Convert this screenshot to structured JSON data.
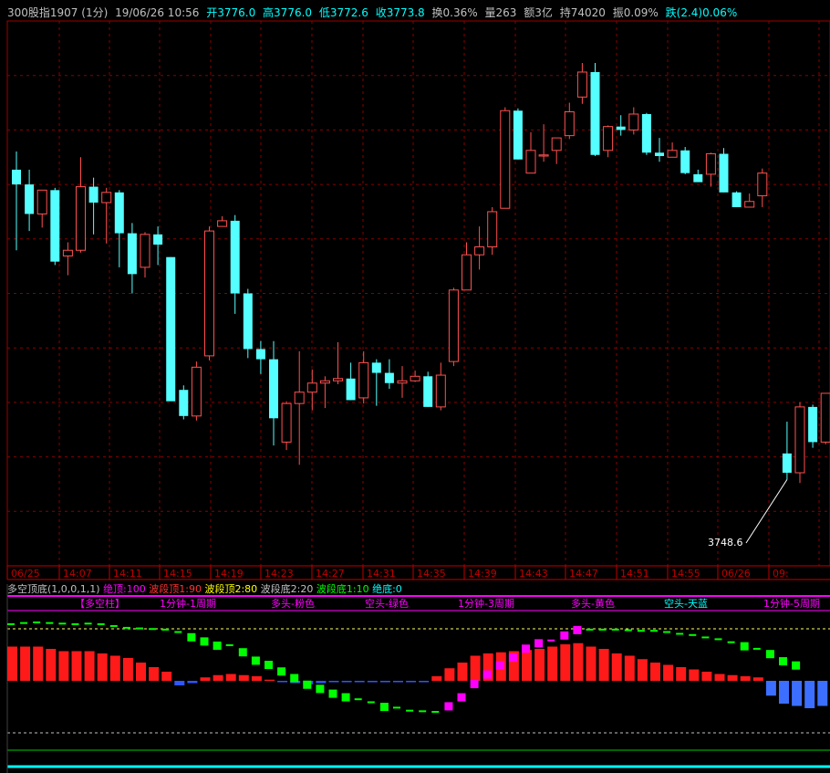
{
  "header": {
    "symbol": "300股指1907 (1分)",
    "datetime": "19/06/26 10:56",
    "open": "开3776.0",
    "high": "高3776.0",
    "low": "低3772.6",
    "close": "收3773.8",
    "turnover": "换0.36%",
    "volume": "量263",
    "amount": "额3亿",
    "position": "持74020",
    "amplitude": "振0.09%",
    "change": "跌(2.4)0.06%",
    "colors": {
      "neutral": "#c0c0c0",
      "up": "#ff5050",
      "down": "#00ffff",
      "amber": "#ffff00"
    }
  },
  "price_panel": {
    "low_annotation": "3748.6"
  },
  "chart_data": {
    "type": "candlestick",
    "candles": [
      [
        3775.9,
        3777.5,
        3768.8,
        3774.6
      ],
      [
        3774.6,
        3775.9,
        3770.5,
        3772.0
      ],
      [
        3772.0,
        3774.0,
        3770.8,
        3774.1
      ],
      [
        3774.1,
        3774.3,
        3767.5,
        3767.8
      ],
      [
        3768.3,
        3769.5,
        3766.6,
        3768.8
      ],
      [
        3768.8,
        3777.0,
        3768.6,
        3774.4
      ],
      [
        3774.4,
        3775.2,
        3770.2,
        3773.0
      ],
      [
        3773.0,
        3774.3,
        3769.4,
        3773.9
      ],
      [
        3773.9,
        3774.1,
        3767.3,
        3770.3
      ],
      [
        3770.3,
        3771.2,
        3765.0,
        3766.7
      ],
      [
        3767.3,
        3770.4,
        3766.4,
        3770.2
      ],
      [
        3770.2,
        3770.9,
        3767.5,
        3769.3
      ],
      [
        3768.2,
        3768.2,
        3755.6,
        3755.5
      ],
      [
        3756.5,
        3756.9,
        3753.9,
        3754.2
      ],
      [
        3754.2,
        3759.0,
        3753.8,
        3758.5
      ],
      [
        3759.5,
        3770.9,
        3759.1,
        3770.5
      ],
      [
        3770.9,
        3771.8,
        3771.1,
        3771.4
      ],
      [
        3771.4,
        3771.9,
        3763.2,
        3765.0
      ],
      [
        3765.0,
        3765.4,
        3759.3,
        3760.1
      ],
      [
        3760.1,
        3760.8,
        3757.9,
        3759.2
      ],
      [
        3759.2,
        3760.8,
        3751.6,
        3754.0
      ],
      [
        3751.9,
        3755.5,
        3751.2,
        3755.3
      ],
      [
        3755.3,
        3759.9,
        3749.9,
        3756.3
      ],
      [
        3756.3,
        3758.3,
        3754.7,
        3757.1
      ],
      [
        3757.1,
        3757.7,
        3754.9,
        3757.3
      ],
      [
        3757.3,
        3760.7,
        3757.0,
        3757.5
      ],
      [
        3757.5,
        3758.9,
        3755.6,
        3755.6
      ],
      [
        3755.8,
        3759.9,
        3755.3,
        3758.9
      ],
      [
        3758.9,
        3759.2,
        3755.1,
        3758.0
      ],
      [
        3758.0,
        3759.2,
        3756.6,
        3757.1
      ],
      [
        3757.1,
        3758.6,
        3755.8,
        3757.3
      ],
      [
        3757.3,
        3758.2,
        3757.2,
        3757.7
      ],
      [
        3757.7,
        3758.1,
        3755.0,
        3755.0
      ],
      [
        3755.0,
        3758.9,
        3754.7,
        3757.8
      ],
      [
        3759.0,
        3765.5,
        3758.6,
        3765.3
      ],
      [
        3765.3,
        3769.5,
        3765.3,
        3768.4
      ],
      [
        3768.4,
        3770.9,
        3767.1,
        3769.1
      ],
      [
        3769.1,
        3772.6,
        3768.4,
        3772.2
      ],
      [
        3772.5,
        3781.4,
        3772.5,
        3781.1
      ],
      [
        3781.1,
        3781.3,
        3776.8,
        3776.8
      ],
      [
        3775.6,
        3779.2,
        3775.6,
        3777.6
      ],
      [
        3777.1,
        3779.9,
        3776.6,
        3777.2
      ],
      [
        3777.6,
        3778.5,
        3776.4,
        3778.7
      ],
      [
        3778.9,
        3781.8,
        3778.6,
        3781.0
      ],
      [
        3782.3,
        3785.3,
        3781.7,
        3784.5
      ],
      [
        3784.5,
        3785.3,
        3777.1,
        3777.2
      ],
      [
        3777.6,
        3779.8,
        3777.0,
        3779.7
      ],
      [
        3779.7,
        3780.7,
        3778.9,
        3779.4
      ],
      [
        3779.4,
        3781.4,
        3779.0,
        3780.8
      ],
      [
        3780.8,
        3780.9,
        3777.2,
        3777.4
      ],
      [
        3777.4,
        3778.7,
        3776.6,
        3777.1
      ],
      [
        3777.0,
        3778.3,
        3777.1,
        3777.6
      ],
      [
        3777.6,
        3777.9,
        3775.5,
        3775.6
      ],
      [
        3775.5,
        3775.9,
        3774.9,
        3774.8
      ],
      [
        3775.5,
        3777.4,
        3774.4,
        3777.3
      ],
      [
        3777.3,
        3777.8,
        3773.9,
        3773.9
      ],
      [
        3773.9,
        3774.0,
        3772.6,
        3772.6
      ],
      [
        3772.6,
        3773.8,
        3772.8,
        3773.1
      ],
      [
        3773.6,
        3776.0,
        3772.6,
        3775.6
      ],
      [
        3750.9,
        3753.7,
        3748.6,
        3749.2
      ],
      [
        3749.2,
        3755.4,
        3748.3,
        3755.0
      ],
      [
        3755.0,
        3755.2,
        3751.4,
        3751.9
      ],
      [
        3751.9,
        3756.1,
        3751.7,
        3756.2
      ],
      [
        3756.3,
        3756.7,
        3755.6,
        3755.8
      ],
      [
        3756.1,
        3761.8,
        3756.0,
        3756.8
      ]
    ],
    "x_axis_labels": [
      "06/25",
      "14:07",
      "14:11",
      "14:15",
      "14:19",
      "14:23",
      "14:27",
      "14:31",
      "14:35",
      "14:39",
      "14:43",
      "14:47",
      "14:51",
      "14:55",
      "06/26",
      "09:"
    ],
    "grid": true,
    "up_color": "#ff5050",
    "down_color": "#55ffff"
  },
  "indicator": {
    "name": "多空顶底(1,0,0,1,1)",
    "params": [
      {
        "text": "绝顶:100",
        "color": "#ff00ff"
      },
      {
        "text": "波段顶1:90",
        "color": "#ff3333"
      },
      {
        "text": "波段顶2:80",
        "color": "#ffff00"
      },
      {
        "text": "波段底2:20",
        "color": "#c0c0c0"
      },
      {
        "text": "波段底1:10",
        "color": "#00ff00"
      },
      {
        "text": "绝底:0",
        "color": "#00ffff"
      }
    ],
    "legend": [
      {
        "text": "【多空柱】",
        "color": "#ff00ff"
      },
      {
        "text": "1分钟-1周期",
        "color": "#ff00ff"
      },
      {
        "text": "多头-粉色",
        "color": "#ff00ff"
      },
      {
        "text": "空头-绿色",
        "color": "#ff00ff"
      },
      {
        "text": "1分钟-3周期",
        "color": "#ff00ff"
      },
      {
        "text": "多头-黄色",
        "color": "#ff00ff"
      },
      {
        "text": "空头-天蓝",
        "color": "#00ffff"
      },
      {
        "text": "1分钟-5周期",
        "color": "#ff00ff"
      }
    ],
    "bar_values": [
      3.0,
      3.0,
      3.0,
      2.8,
      2.6,
      2.6,
      2.6,
      2.4,
      2.2,
      2.0,
      1.6,
      1.2,
      0.8,
      -0.4,
      -0.2,
      0.3,
      0.5,
      0.6,
      0.5,
      0.4,
      0.1,
      -0.1,
      -0.2,
      -0.3,
      -0.2,
      -0.1,
      -0.1,
      -0.1,
      -0.1,
      -0.1,
      -0.1,
      -0.1,
      -0.1,
      0.4,
      1.1,
      1.6,
      2.2,
      2.4,
      2.5,
      2.6,
      2.7,
      2.8,
      3.0,
      3.2,
      3.3,
      3.0,
      2.8,
      2.4,
      2.2,
      1.9,
      1.6,
      1.4,
      1.2,
      1.0,
      0.8,
      0.6,
      0.5,
      0.4,
      0.3,
      -1.3,
      -2.0,
      -2.2,
      -2.4,
      -2.2,
      -1.9
    ],
    "dot_values": [
      84,
      86,
      87,
      86,
      85,
      84,
      85,
      84,
      81,
      78,
      77,
      76,
      75,
      71,
      63,
      56,
      49,
      49,
      38,
      24,
      17,
      6,
      -5,
      -16,
      -23,
      -31,
      -37,
      -41,
      -46,
      -53,
      -55,
      -60,
      -61,
      -62,
      -52,
      -37,
      -15,
      1,
      16,
      29,
      44,
      53,
      57,
      66,
      75,
      75,
      75,
      75,
      74,
      73,
      73,
      71,
      68,
      66,
      62,
      59,
      54,
      48,
      43,
      35,
      23,
      16
    ]
  }
}
